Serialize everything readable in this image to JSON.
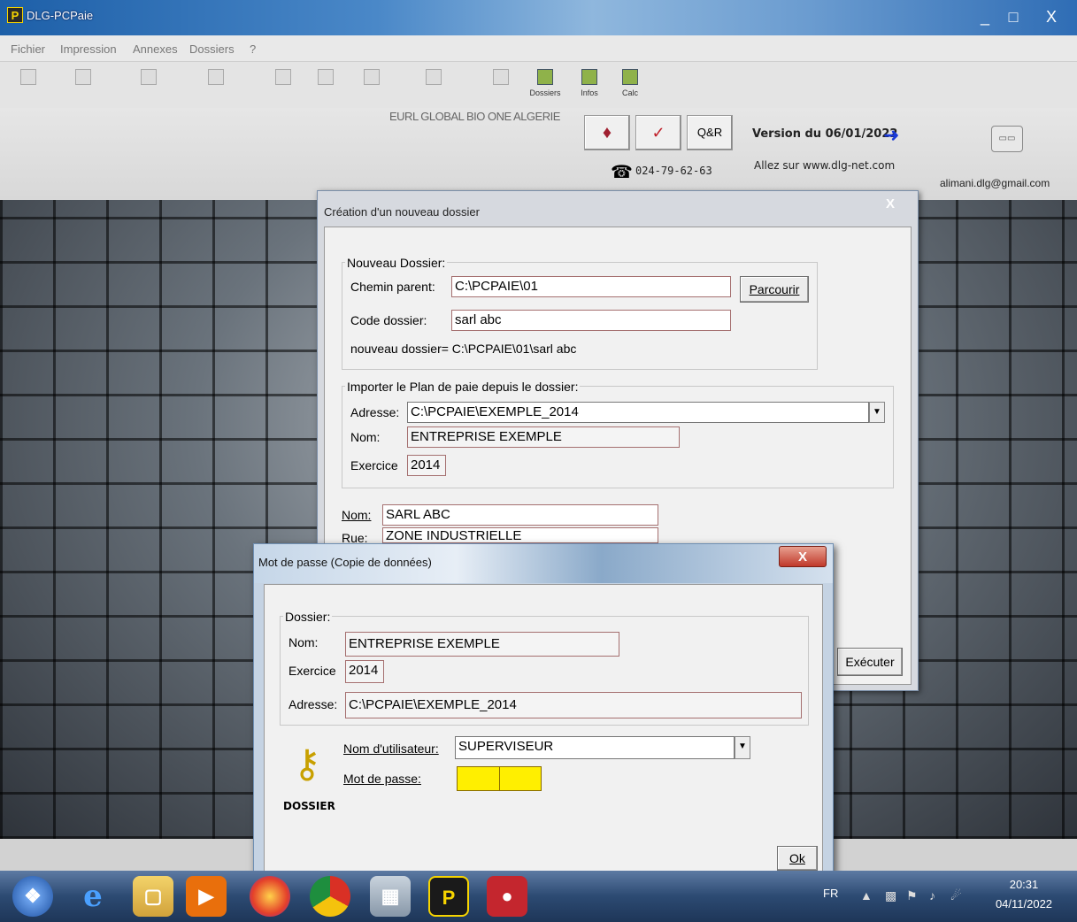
{
  "window": {
    "title": "DLG-PCPaie",
    "logo": "P",
    "minimize": "_",
    "maximize": "□",
    "close": "X"
  },
  "menu": [
    "Fichier",
    "Impression",
    "Annexes",
    "Dossiers",
    "?"
  ],
  "toolbar": {
    "dossiers_label": "Dossiers",
    "infos_label": "Infos",
    "calc_label": "Calc"
  },
  "banner": {
    "company": "EURL GLOBAL BIO ONE ALGERIE",
    "qr_label": "Q&R",
    "phone": "024-79-62-63",
    "version": "Version du 06/01/2022",
    "website": "Allez sur  www.dlg-net.com",
    "email": "alimani.dlg@gmail.com"
  },
  "dialog1": {
    "title": "Création d'un nouveau dossier",
    "close": "X",
    "group_new": {
      "label": "Nouveau Dossier:",
      "chemin_label": "Chemin parent:",
      "chemin_value": "C:\\PCPAIE\\01",
      "parcourir": "Parcourir",
      "code_label": "Code dossier:",
      "code_value": "sarl abc",
      "result": "nouveau dossier= C:\\PCPAIE\\01\\sarl abc"
    },
    "group_import": {
      "label": "Importer le Plan de paie depuis le dossier:",
      "adresse_label": "Adresse:",
      "adresse_value": "C:\\PCPAIE\\EXEMPLE_2014",
      "nom_label": "Nom:",
      "nom_value": "ENTREPRISE EXEMPLE",
      "exercice_label": "Exercice",
      "exercice_value": "2014"
    },
    "nom_label": "Nom:",
    "nom_value": "SARL ABC",
    "rue_label": "Rue:",
    "rue_value": "ZONE INDUSTRIELLE",
    "executer": "Exécuter"
  },
  "dialog2": {
    "title": "Mot de passe (Copie de données)",
    "close": "X",
    "group_label": "Dossier:",
    "nom_label": "Nom:",
    "nom_value": "ENTREPRISE EXEMPLE",
    "exercice_label": "Exercice",
    "exercice_value": "2014",
    "adresse_label": "Adresse:",
    "adresse_value": "C:\\PCPAIE\\EXEMPLE_2014",
    "user_label": "Nom d'utilisateur:",
    "user_value": "SUPERVISEUR",
    "password_label": "Mot de passe:",
    "key_caption": "DOSSIER",
    "ok": "Ok"
  },
  "taskbar": {
    "lang": "FR",
    "time": "20:31",
    "date": "04/11/2022"
  }
}
